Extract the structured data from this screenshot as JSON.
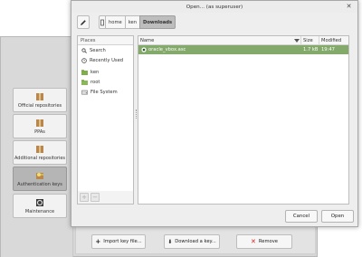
{
  "colors": {
    "accent_selection": "#83a96b",
    "dialog_bg": "#eeeeee",
    "window_bg": "#d6d6d6"
  },
  "background_window": {
    "sidebar": {
      "items": [
        {
          "label": "Official repositories",
          "icon": "package-icon",
          "active": false
        },
        {
          "label": "PPAs",
          "icon": "package-icon",
          "active": false
        },
        {
          "label": "Additional repositories",
          "icon": "package-icon",
          "active": false
        },
        {
          "label": "Authentication keys",
          "icon": "key-package-icon",
          "active": true
        },
        {
          "label": "Maintenance",
          "icon": "maintenance-icon",
          "active": false
        }
      ]
    },
    "actions": {
      "import_label": "Import key file...",
      "download_label": "Download a key...",
      "remove_label": "Remove"
    }
  },
  "dialog": {
    "title": "Open... (as superuser)",
    "pathbar": {
      "edit_icon": "pencil-icon",
      "crumbs": [
        "home",
        "ken",
        "Downloads"
      ],
      "active_crumb": "Downloads"
    },
    "places": {
      "header": "Places",
      "items": [
        {
          "label": "Search",
          "icon": "search-icon"
        },
        {
          "label": "Recently Used",
          "icon": "clock-icon"
        },
        {
          "label": "ken",
          "icon": "home-folder-icon"
        },
        {
          "label": "root",
          "icon": "folder-icon"
        },
        {
          "label": "File System",
          "icon": "drive-icon"
        }
      ],
      "add_symbol": "+",
      "remove_symbol": "−"
    },
    "files": {
      "columns": {
        "name": "Name",
        "size": "Size",
        "modified": "Modified"
      },
      "rows": [
        {
          "name": "oracle_vbox.asc",
          "size": "1.7 kB",
          "modified": "19:47",
          "selected": true
        }
      ]
    },
    "buttons": {
      "cancel": "Cancel",
      "open": "Open"
    }
  }
}
